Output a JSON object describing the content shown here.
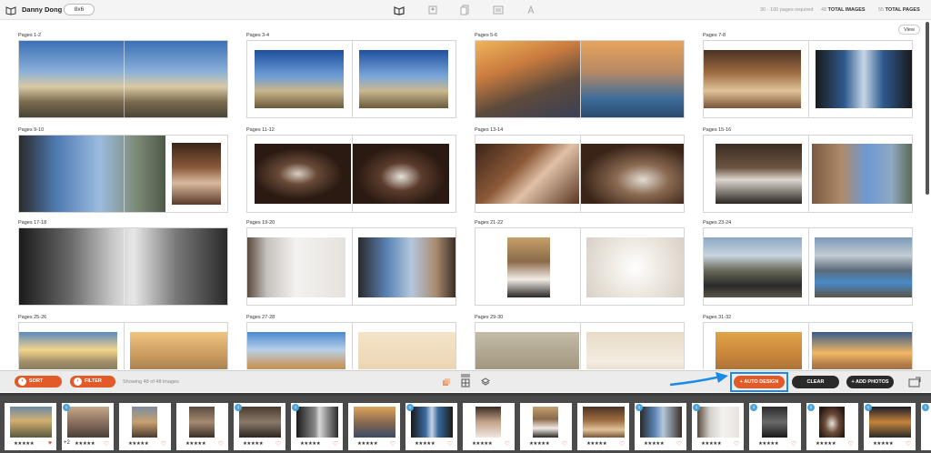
{
  "header": {
    "user_name": "Danny Dong",
    "pill_label": "8x6",
    "nav_icons": [
      "book-layout-icon",
      "people-icon",
      "pages-icon",
      "spread-icon",
      "settings-icon"
    ],
    "pages_required": "30 - 100 pages required",
    "total_images_value": "48",
    "total_images_label": "TOTAL IMAGES",
    "total_pages_value": "55",
    "total_pages_label": "TOTAL PAGES",
    "view_label": "View"
  },
  "spreads": [
    {
      "label": "Pages 1-2"
    },
    {
      "label": "Pages 3-4"
    },
    {
      "label": "Pages 5-6"
    },
    {
      "label": "Pages 7-8"
    },
    {
      "label": "Pages 9-10"
    },
    {
      "label": "Pages 11-12"
    },
    {
      "label": "Pages 13-14"
    },
    {
      "label": "Pages 15-16"
    },
    {
      "label": "Pages 17-18"
    },
    {
      "label": "Pages 19-20"
    },
    {
      "label": "Pages 21-22"
    },
    {
      "label": "Pages 23-24"
    },
    {
      "label": "Pages 25-26"
    },
    {
      "label": "Pages 27-28"
    },
    {
      "label": "Pages 29-30"
    },
    {
      "label": "Pages 31-32"
    }
  ],
  "toolbar": {
    "sort_label": "SORT",
    "filter_label": "FILTER",
    "showing_text": "Showing 48 of 48 images",
    "auto_design_label": "+ AUTO DESIGN",
    "clear_label": "CLEAR",
    "add_photos_label": "+ ADD PHOTOS"
  },
  "tray": {
    "plus_count": "+2",
    "stars": "★★★★★"
  },
  "colors": {
    "accent": "#e15a27",
    "highlight": "#1a8ce8",
    "dark_button": "#2a2a2a",
    "tray_bg": "#4a4a4a"
  }
}
